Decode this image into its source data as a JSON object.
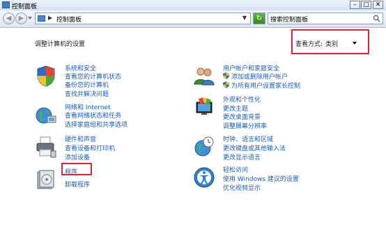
{
  "window": {
    "title": "控制面板"
  },
  "address": {
    "path": "控制面板",
    "search_placeholder": "搜索控制面板"
  },
  "main": {
    "heading": "调整计算机的设置",
    "view_by": {
      "label": "查看方式:",
      "value": "类别"
    }
  },
  "categories_left": [
    {
      "title": "系统和安全",
      "icon": "shield-icon",
      "links": [
        "查看您的计算机状态",
        "备份您的计算机",
        "查找并解决问题"
      ]
    },
    {
      "title": "网络和 Internet",
      "icon": "network-globe-icon",
      "links": [
        "查看网络状态和任务",
        "选择家庭组和共享选项"
      ]
    },
    {
      "title": "硬件和声音",
      "icon": "printer-icon",
      "links": [
        "查看设备和打印机",
        "添加设备"
      ]
    },
    {
      "title": "程序",
      "icon": "programs-icon",
      "links": [
        "卸载程序"
      ]
    }
  ],
  "categories_right": [
    {
      "title": "用户帐户和家庭安全",
      "icon": "users-icon",
      "links": [
        "添加或删除用户帐户",
        "为所有用户设置家长控制"
      ]
    },
    {
      "title": "外观和个性化",
      "icon": "monitor-color-icon",
      "links": [
        "更改主题",
        "更改桌面背景",
        "调整屏幕分辨率"
      ]
    },
    {
      "title": "时钟、语言和区域",
      "icon": "clock-globe-icon",
      "links": [
        "更改键盘或其他输入法",
        "更改显示语言"
      ]
    },
    {
      "title": "轻松访问",
      "icon": "ease-of-access-icon",
      "links": [
        "使用 Windows 建议的设置",
        "优化视频显示"
      ]
    }
  ]
}
